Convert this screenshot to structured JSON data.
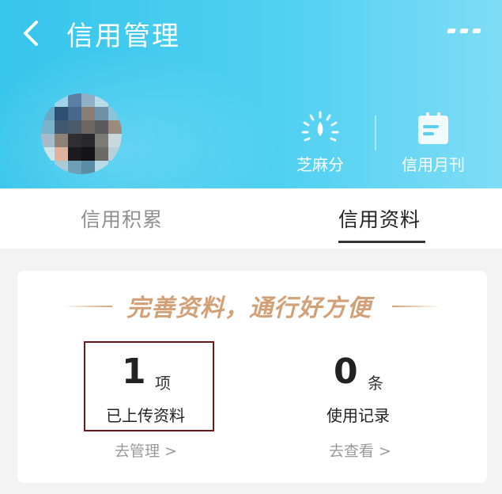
{
  "header": {
    "title": "信用管理",
    "back_icon": "chevron-left-icon",
    "more_icon": "more-icon",
    "background_color": "#3cc8ee",
    "buttons": [
      {
        "label": "芝麻分",
        "icon": "zhima-score-icon"
      },
      {
        "label": "信用月刊",
        "icon": "calendar-icon"
      }
    ]
  },
  "tabs": [
    {
      "label": "信用积累",
      "active": false
    },
    {
      "label": "信用资料",
      "active": true
    }
  ],
  "card": {
    "slogan": "完善资料，通行好方便",
    "stats": [
      {
        "value": "1",
        "unit": "项",
        "label": "已上传资料",
        "link": "去管理 >"
      },
      {
        "value": "0",
        "unit": "条",
        "label": "使用记录",
        "link": "去查看 >"
      }
    ]
  },
  "colors": {
    "accent_gold": "#d2a077",
    "highlight_border": "#6b1a1a"
  }
}
